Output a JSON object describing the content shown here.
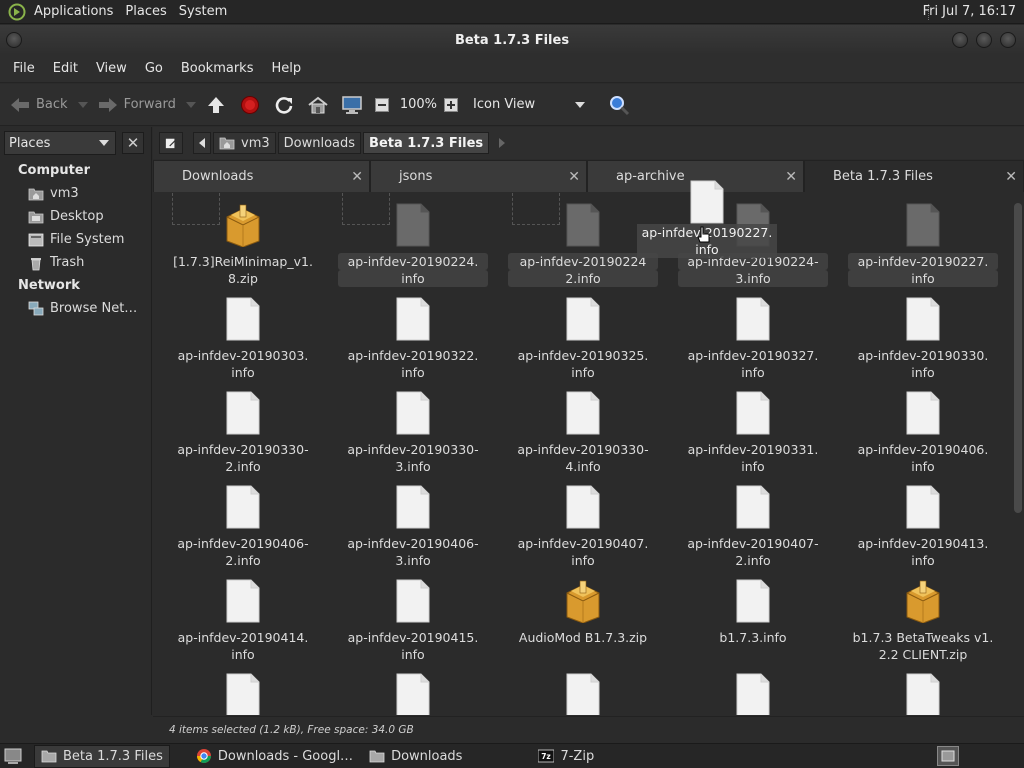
{
  "top_panel": {
    "menus": [
      "Applications",
      "Places",
      "System"
    ],
    "clock": "Fri Jul  7, 16:17"
  },
  "window": {
    "title": "Beta 1.7.3 Files"
  },
  "menubar": [
    "File",
    "Edit",
    "View",
    "Go",
    "Bookmarks",
    "Help"
  ],
  "toolbar": {
    "back_label": "Back",
    "forward_label": "Forward",
    "zoom": "100%",
    "view_mode": "Icon View"
  },
  "sidepane": {
    "selector": "Places",
    "groups": [
      {
        "label": "Computer",
        "items": [
          "vm3",
          "Desktop",
          "File System",
          "Trash"
        ]
      },
      {
        "label": "Network",
        "items": [
          "Browse Net…"
        ]
      }
    ]
  },
  "location": {
    "crumbs": [
      "vm3",
      "Downloads",
      "Beta 1.7.3 Files"
    ]
  },
  "tabs": [
    "Downloads",
    "jsons",
    "ap-archive",
    "Beta 1.7.3 Files"
  ],
  "files": [
    {
      "line1": "[1.7.3]ReiMinimap_v1.",
      "line2": "8.zip",
      "type": "zip",
      "selected": false
    },
    {
      "line1": "ap-infdev-20190224.",
      "line2": "info",
      "type": "doc",
      "selected": true
    },
    {
      "line1": "ap-infdev-20190224",
      "line2": "2.info",
      "type": "doc",
      "selected": true
    },
    {
      "line1": "ap-infdev-20190224-",
      "line2": "3.info",
      "type": "doc",
      "selected": true
    },
    {
      "line1": "ap-infdev-20190227.",
      "line2": "info",
      "type": "doc",
      "selected": true
    },
    {
      "line1": "ap-infdev-20190303.",
      "line2": "info",
      "type": "doc",
      "selected": false
    },
    {
      "line1": "ap-infdev-20190322.",
      "line2": "info",
      "type": "doc",
      "selected": false
    },
    {
      "line1": "ap-infdev-20190325.",
      "line2": "info",
      "type": "doc",
      "selected": false
    },
    {
      "line1": "ap-infdev-20190327.",
      "line2": "info",
      "type": "doc",
      "selected": false
    },
    {
      "line1": "ap-infdev-20190330.",
      "line2": "info",
      "type": "doc",
      "selected": false
    },
    {
      "line1": "ap-infdev-20190330-",
      "line2": "2.info",
      "type": "doc",
      "selected": false
    },
    {
      "line1": "ap-infdev-20190330-",
      "line2": "3.info",
      "type": "doc",
      "selected": false
    },
    {
      "line1": "ap-infdev-20190330-",
      "line2": "4.info",
      "type": "doc",
      "selected": false
    },
    {
      "line1": "ap-infdev-20190331.",
      "line2": "info",
      "type": "doc",
      "selected": false
    },
    {
      "line1": "ap-infdev-20190406.",
      "line2": "info",
      "type": "doc",
      "selected": false
    },
    {
      "line1": "ap-infdev-20190406-",
      "line2": "2.info",
      "type": "doc",
      "selected": false
    },
    {
      "line1": "ap-infdev-20190406-",
      "line2": "3.info",
      "type": "doc",
      "selected": false
    },
    {
      "line1": "ap-infdev-20190407.",
      "line2": "info",
      "type": "doc",
      "selected": false
    },
    {
      "line1": "ap-infdev-20190407-",
      "line2": "2.info",
      "type": "doc",
      "selected": false
    },
    {
      "line1": "ap-infdev-20190413.",
      "line2": "info",
      "type": "doc",
      "selected": false
    },
    {
      "line1": "ap-infdev-20190414.",
      "line2": "info",
      "type": "doc",
      "selected": false
    },
    {
      "line1": "ap-infdev-20190415.",
      "line2": "info",
      "type": "doc",
      "selected": false
    },
    {
      "line1": "AudioMod B1.7.3.zip",
      "line2": "",
      "type": "zip",
      "selected": false
    },
    {
      "line1": "b1.7.3.info",
      "line2": "",
      "type": "doc",
      "selected": false
    },
    {
      "line1": "b1.7.3 BetaTweaks v1.",
      "line2": "2.2 CLIENT.zip",
      "type": "zip",
      "selected": false
    },
    {
      "line1": "",
      "line2": "",
      "type": "doc",
      "selected": false
    },
    {
      "line1": "",
      "line2": "",
      "type": "doc",
      "selected": false
    },
    {
      "line1": "",
      "line2": "",
      "type": "doc",
      "selected": false
    },
    {
      "line1": "",
      "line2": "",
      "type": "doc",
      "selected": false
    },
    {
      "line1": "",
      "line2": "",
      "type": "doc",
      "selected": false
    }
  ],
  "drag_ghost": {
    "line1": "ap-infdev-20190227.",
    "line2": "info"
  },
  "status": "4 items selected (1.2 kB), Free space: 34.0 GB",
  "taskbar": [
    {
      "label": "Beta 1.7.3 Files",
      "icon": "folder-icon",
      "active": true
    },
    {
      "label": "Downloads - Googl…",
      "icon": "chrome-icon",
      "active": false
    },
    {
      "label": "Downloads",
      "icon": "folder-icon",
      "active": false
    },
    {
      "label": "7-Zip",
      "icon": "7zip-icon",
      "active": false
    }
  ],
  "colors": {
    "background": "#2b2b2b",
    "panel": "#262626",
    "zip_accent": "#e8a93c",
    "selection": "#3f3f3f"
  }
}
